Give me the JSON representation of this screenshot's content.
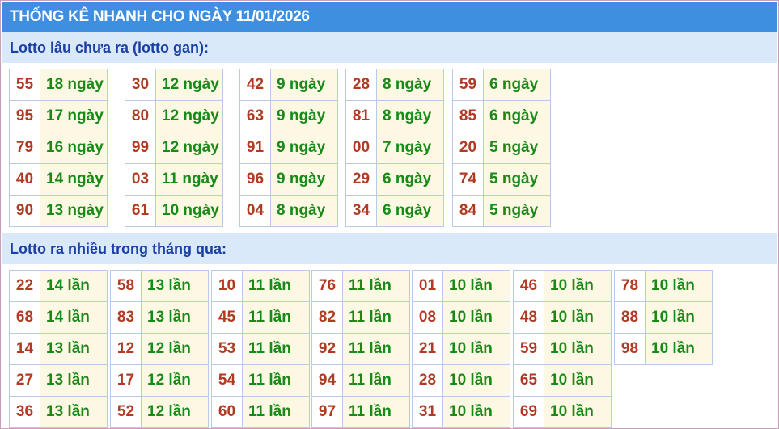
{
  "title": "THỐNG KÊ NHANH CHO NGÀY 11/01/2026",
  "gan": {
    "heading": "Lotto lâu chưa ra (lotto gan):",
    "groups": [
      [
        {
          "num": "55",
          "val": "18 ngày"
        },
        {
          "num": "95",
          "val": "17 ngày"
        },
        {
          "num": "79",
          "val": "16 ngày"
        },
        {
          "num": "40",
          "val": "14 ngày"
        },
        {
          "num": "90",
          "val": "13 ngày"
        }
      ],
      [
        {
          "num": "30",
          "val": "12 ngày"
        },
        {
          "num": "80",
          "val": "12 ngày"
        },
        {
          "num": "99",
          "val": "12 ngày"
        },
        {
          "num": "03",
          "val": "11 ngày"
        },
        {
          "num": "61",
          "val": "10 ngày"
        }
      ],
      [
        {
          "num": "42",
          "val": "9 ngày"
        },
        {
          "num": "63",
          "val": "9 ngày"
        },
        {
          "num": "91",
          "val": "9 ngày"
        },
        {
          "num": "96",
          "val": "9 ngày"
        },
        {
          "num": "04",
          "val": "8 ngày"
        }
      ],
      [
        {
          "num": "28",
          "val": "8 ngày"
        },
        {
          "num": "81",
          "val": "8 ngày"
        },
        {
          "num": "00",
          "val": "7 ngày"
        },
        {
          "num": "29",
          "val": "6 ngày"
        },
        {
          "num": "34",
          "val": "6 ngày"
        }
      ],
      [
        {
          "num": "59",
          "val": "6 ngày"
        },
        {
          "num": "85",
          "val": "6 ngày"
        },
        {
          "num": "20",
          "val": "5 ngày"
        },
        {
          "num": "74",
          "val": "5 ngày"
        },
        {
          "num": "84",
          "val": "5 ngày"
        }
      ]
    ]
  },
  "frequent": {
    "heading": "Lotto ra nhiều trong tháng qua:",
    "groups": [
      [
        {
          "num": "22",
          "val": "14 lần"
        },
        {
          "num": "68",
          "val": "14 lần"
        },
        {
          "num": "14",
          "val": "13 lần"
        },
        {
          "num": "27",
          "val": "13 lần"
        },
        {
          "num": "36",
          "val": "13 lần"
        }
      ],
      [
        {
          "num": "58",
          "val": "13 lần"
        },
        {
          "num": "83",
          "val": "13 lần"
        },
        {
          "num": "12",
          "val": "12 lần"
        },
        {
          "num": "17",
          "val": "12 lần"
        },
        {
          "num": "52",
          "val": "12 lần"
        }
      ],
      [
        {
          "num": "10",
          "val": "11 lần"
        },
        {
          "num": "45",
          "val": "11 lần"
        },
        {
          "num": "53",
          "val": "11 lần"
        },
        {
          "num": "54",
          "val": "11 lần"
        },
        {
          "num": "60",
          "val": "11 lần"
        }
      ],
      [
        {
          "num": "76",
          "val": "11 lần"
        },
        {
          "num": "82",
          "val": "11 lần"
        },
        {
          "num": "92",
          "val": "11 lần"
        },
        {
          "num": "94",
          "val": "11 lần"
        },
        {
          "num": "97",
          "val": "11 lần"
        }
      ],
      [
        {
          "num": "01",
          "val": "10 lần"
        },
        {
          "num": "08",
          "val": "10 lần"
        },
        {
          "num": "21",
          "val": "10 lần"
        },
        {
          "num": "28",
          "val": "10 lần"
        },
        {
          "num": "31",
          "val": "10 lần"
        }
      ],
      [
        {
          "num": "46",
          "val": "10 lần"
        },
        {
          "num": "48",
          "val": "10 lần"
        },
        {
          "num": "59",
          "val": "10 lần"
        },
        {
          "num": "65",
          "val": "10 lần"
        },
        {
          "num": "69",
          "val": "10 lần"
        }
      ],
      [
        {
          "num": "78",
          "val": "10 lần"
        },
        {
          "num": "88",
          "val": "10 lần"
        },
        {
          "num": "98",
          "val": "10 lần"
        }
      ]
    ]
  },
  "colors": {
    "title_bg": "#3f8fe0",
    "section_bg": "#d9e9fa",
    "section_text": "#1a3fa6",
    "number_text": "#b03a22",
    "value_text": "#178a17",
    "value_bg": "#fdf8e4",
    "border": "#b7cbe6"
  }
}
